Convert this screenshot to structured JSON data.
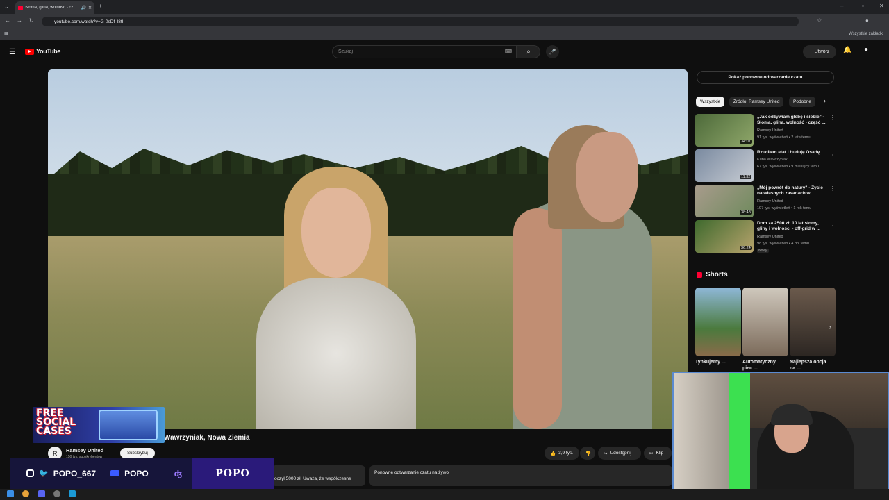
{
  "browser": {
    "tab_title": "Słoma, glina, wolność - cz...",
    "url": "youtube.com/watch?v=G-0sDf_l8tI",
    "bookmarks_label": "Wszystkie zakładki"
  },
  "youtube": {
    "logo": "YouTube",
    "search_placeholder": "Szukaj",
    "create_label": "Utwórz"
  },
  "right_column": {
    "live_chat_button": "Pokaż ponowne odtwarzanie czatu",
    "chips": [
      "Wszystkie",
      "Źródło: Ramsey United",
      "Podobne"
    ],
    "recommendations": [
      {
        "title": "„Jak odżywiam glebę i siebie\" - Słoma, glina, wolność - część ...",
        "channel": "Ramsey United",
        "meta": "91 tys. wyświetleń • 2 lata temu",
        "duration": "34:07",
        "badge": ""
      },
      {
        "title": "Rzuciłem etat i buduję Osadę",
        "channel": "Kuba Wawrzyniak",
        "meta": "67 tys. wyświetleń • 9 miesięcy temu",
        "duration": "11:32",
        "badge": ""
      },
      {
        "title": "„Mój powrót do natury\" - Życie na własnych zasadach w ...",
        "channel": "Ramsey United",
        "meta": "197 tys. wyświetleń • 1 rok temu",
        "duration": "38:48",
        "badge": ""
      },
      {
        "title": "Dom za 2500 zł: 10 lat słomy, gliny i wolności - off-grid w ...",
        "channel": "Ramsey United",
        "meta": "98 tys. wyświetleń • 4 dni temu",
        "duration": "36:24",
        "badge": "Nowy"
      }
    ],
    "shorts_heading": "Shorts",
    "shorts": [
      {
        "title": "Tynkujemy ..."
      },
      {
        "title": "Automatyczny piec ..."
      },
      {
        "title": "Najlepsza opcja na ..."
      }
    ]
  },
  "video": {
    "title_visible": "Wawrzyniak, Nowa Ziemia",
    "channel": "Ramsey United",
    "subscribers": "150 tys. subskrybentów",
    "subscribe_label": "Subskrybuj",
    "likes": "3,9 tys.",
    "share_label": "Udostępnij",
    "clip_label": "Klip",
    "description_snippet": "oczył 5000 zł. Uważa, że współczesne",
    "chat_replay_label": "Ponowne odtwarzanie czatu na żywo"
  },
  "overlay": {
    "promo_text": "FREE SOCIAL CASES",
    "social_handle_1": "POPO_667",
    "social_handle_2": "POPO",
    "brand": "POPO"
  },
  "colors": {
    "yt_red": "#ff0000",
    "bg": "#0f0f0f",
    "chip_bg": "#272727"
  }
}
